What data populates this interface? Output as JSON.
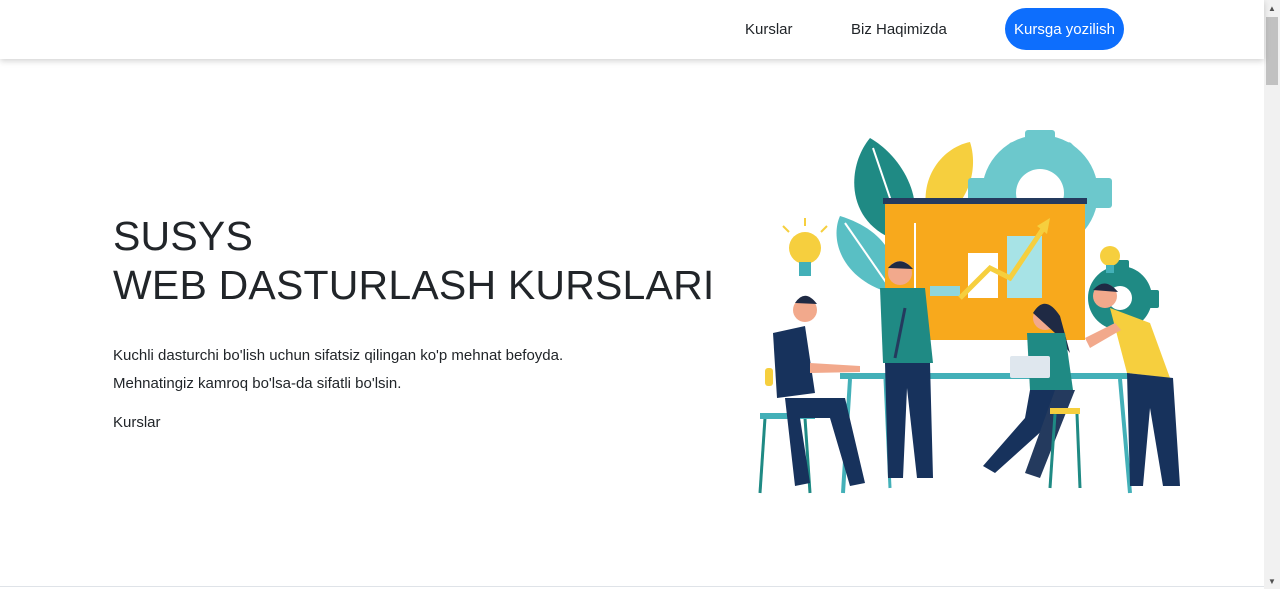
{
  "nav": {
    "courses": "Kurslar",
    "about": "Biz Haqimizda",
    "cta": "Kursga yozilish"
  },
  "hero": {
    "title_line1": "SUSYS",
    "title_line2": "WEB DASTURLASH KURSLARI",
    "text_line1": "Kuchli dasturchi bo'lish uchun sifatsiz qilingan ko'p mehnat befoyda.",
    "text_line2": "Mehnatingiz kamroq bo'lsa-da sifatli bo'lsin.",
    "link": "Kurslar"
  },
  "colors": {
    "accent": "#0d6efd",
    "teal": "#1f8a84",
    "navy": "#17325c",
    "yellow": "#f6b824"
  },
  "icons": {
    "scroll_up": "▲",
    "scroll_down": "▼"
  }
}
